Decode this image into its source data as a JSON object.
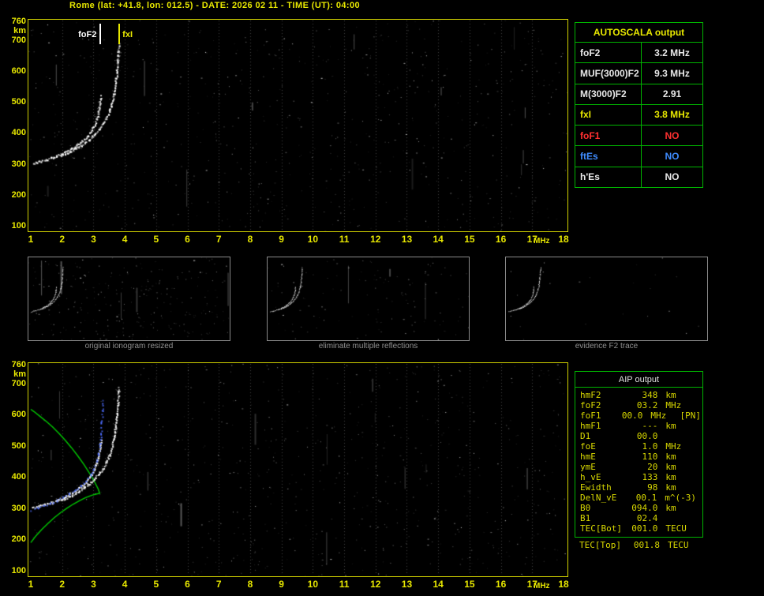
{
  "header": {
    "title": "Rome (lat: +41.8, lon: 012.5) - DATE: 2026 02 11 - TIME (UT): 04:00"
  },
  "colors": {
    "background": "#000000",
    "axis_yellow": "#e8e800",
    "plot_border": "#d0d000",
    "table_green": "#00b400",
    "white": "#e8e8e8",
    "red": "#ff3030",
    "blue": "#3f8cff",
    "trace_white": "#ffffff",
    "restored_blue": "#4d6dff",
    "profile_green": "#00c800",
    "caption_gray": "#8f8f8f",
    "aip_text": "#d8d800"
  },
  "autoscala_table": {
    "title": "AUTOSCALA output",
    "rows": [
      {
        "label": "foF2",
        "value": "3.2 MHz",
        "color": "#e8e8e8"
      },
      {
        "label": "MUF(3000)F2",
        "value": "9.3 MHz",
        "color": "#e8e8e8"
      },
      {
        "label": "M(3000)F2",
        "value": "2.91",
        "color": "#e8e8e8"
      },
      {
        "label": "fxI",
        "value": "3.8 MHz",
        "color": "#e8e800"
      },
      {
        "label": "foF1",
        "value": "NO",
        "color": "#ff3030"
      },
      {
        "label": "ftEs",
        "value": "NO",
        "color": "#3f8cff"
      },
      {
        "label": "h'Es",
        "value": "NO",
        "color": "#e8e8e8"
      }
    ]
  },
  "thumbnails": [
    {
      "caption": "original ionogram resized"
    },
    {
      "caption": "eliminate multiple reflections"
    },
    {
      "caption": "evidence F2 trace"
    }
  ],
  "aip_panel": {
    "title": "AIP output",
    "rows": [
      {
        "name": "hmF2",
        "value": "348",
        "unit": "km",
        "extra": ""
      },
      {
        "name": "foF2",
        "value": "03.2",
        "unit": "MHz",
        "extra": ""
      },
      {
        "name": "foF1",
        "value": "00.0",
        "unit": "MHz",
        "extra": "[PN]"
      },
      {
        "name": "hmF1",
        "value": "---",
        "unit": "km",
        "extra": ""
      },
      {
        "name": "D1",
        "value": "00.0",
        "unit": "",
        "extra": ""
      },
      {
        "name": "foE",
        "value": "1.0",
        "unit": "MHz",
        "extra": ""
      },
      {
        "name": "hmE",
        "value": "110",
        "unit": "km",
        "extra": ""
      },
      {
        "name": "ymE",
        "value": "20",
        "unit": "km",
        "extra": ""
      },
      {
        "name": "h_vE",
        "value": "133",
        "unit": "km",
        "extra": ""
      },
      {
        "name": "Ewidth",
        "value": "98",
        "unit": "km",
        "extra": ""
      },
      {
        "name": "DelN_vE",
        "value": "00.1",
        "unit": "m^(-3)",
        "extra": ""
      },
      {
        "name": "B0",
        "value": "094.0",
        "unit": "km",
        "extra": ""
      },
      {
        "name": "B1",
        "value": "02.4",
        "unit": "",
        "extra": ""
      },
      {
        "name": "TEC[Bot]",
        "value": "001.0",
        "unit": "TECU",
        "extra": ""
      }
    ],
    "outside_row": {
      "name": "TEC[Top]",
      "value": "001.8",
      "unit": "TECU"
    }
  },
  "chart_data": [
    {
      "type": "scatter",
      "title": "Autoscaled ionogram",
      "xlabel": "MHz",
      "ylabel": "km",
      "xlim": [
        1,
        18
      ],
      "ylim": [
        100,
        760
      ],
      "x_ticks": [
        1,
        2,
        3,
        4,
        5,
        6,
        7,
        8,
        9,
        10,
        11,
        12,
        13,
        14,
        15,
        16,
        17,
        18
      ],
      "y_ticks": [
        760,
        700,
        600,
        500,
        400,
        300,
        200,
        100
      ],
      "grid": "vertical-dotted",
      "legend": "none",
      "series": [
        {
          "name": "F2-trace-O-mode",
          "color": "#ffffff",
          "style": "dots",
          "points": [
            [
              1.05,
              302
            ],
            [
              1.25,
              308
            ],
            [
              1.45,
              314
            ],
            [
              1.65,
              320
            ],
            [
              1.8,
              326
            ],
            [
              1.95,
              332
            ],
            [
              2.1,
              340
            ],
            [
              2.25,
              348
            ],
            [
              2.4,
              357
            ],
            [
              2.55,
              368
            ],
            [
              2.7,
              380
            ],
            [
              2.82,
              394
            ],
            [
              2.93,
              410
            ],
            [
              3.02,
              428
            ],
            [
              3.09,
              448
            ],
            [
              3.15,
              470
            ],
            [
              3.19,
              495
            ],
            [
              3.22,
              520
            ]
          ]
        },
        {
          "name": "F2-trace-X-mode",
          "color": "#ffffff",
          "style": "dots",
          "points": [
            [
              1.95,
              328
            ],
            [
              2.1,
              334
            ],
            [
              2.25,
              341
            ],
            [
              2.4,
              349
            ],
            [
              2.55,
              358
            ],
            [
              2.7,
              368
            ],
            [
              2.85,
              380
            ],
            [
              3.0,
              394
            ],
            [
              3.15,
              410
            ],
            [
              3.28,
              428
            ],
            [
              3.4,
              448
            ],
            [
              3.5,
              472
            ],
            [
              3.58,
              500
            ],
            [
              3.64,
              530
            ],
            [
              3.69,
              562
            ],
            [
              3.73,
              596
            ],
            [
              3.76,
              630
            ],
            [
              3.78,
              660
            ],
            [
              3.8,
              688
            ]
          ]
        }
      ],
      "annotations": [
        {
          "label": "foF2",
          "x": 3.2,
          "color": "#ffffff",
          "side": "left"
        },
        {
          "label": "fxI",
          "x": 3.8,
          "color": "#e8e800",
          "side": "right"
        }
      ]
    },
    {
      "type": "scatter",
      "title": "Ionogram with restored trace and electron density profile",
      "xlabel": "MHz",
      "ylabel": "km",
      "xlim": [
        1,
        18
      ],
      "ylim": [
        100,
        760
      ],
      "x_ticks": [
        1,
        2,
        3,
        4,
        5,
        6,
        7,
        8,
        9,
        10,
        11,
        12,
        13,
        14,
        15,
        16,
        17,
        18
      ],
      "y_ticks": [
        760,
        700,
        600,
        500,
        400,
        300,
        200,
        100
      ],
      "grid": "vertical-dotted",
      "legend": "none",
      "series": [
        {
          "name": "electron-density-profile",
          "color": "#00c800",
          "style": "line",
          "points": [
            [
              1.0,
              190
            ],
            [
              1.15,
              210
            ],
            [
              1.35,
              232
            ],
            [
              1.55,
              252
            ],
            [
              1.75,
              270
            ],
            [
              1.95,
              286
            ],
            [
              2.15,
              300
            ],
            [
              2.35,
              313
            ],
            [
              2.55,
              324
            ],
            [
              2.75,
              334
            ],
            [
              2.95,
              342
            ],
            [
              3.1,
              346
            ],
            [
              3.2,
              348
            ],
            [
              3.15,
              362
            ],
            [
              3.05,
              382
            ],
            [
              2.9,
              408
            ],
            [
              2.7,
              440
            ],
            [
              2.5,
              468
            ],
            [
              2.3,
              494
            ],
            [
              2.1,
              518
            ],
            [
              1.9,
              540
            ],
            [
              1.7,
              560
            ],
            [
              1.5,
              578
            ],
            [
              1.3,
              594
            ],
            [
              1.1,
              610
            ],
            [
              1.0,
              617
            ]
          ]
        },
        {
          "name": "F2-trace-O-mode",
          "color": "#ffffff",
          "style": "dots",
          "points": [
            [
              1.05,
              302
            ],
            [
              1.25,
              308
            ],
            [
              1.45,
              314
            ],
            [
              1.65,
              320
            ],
            [
              1.8,
              326
            ],
            [
              1.95,
              332
            ],
            [
              2.1,
              340
            ],
            [
              2.25,
              348
            ],
            [
              2.4,
              357
            ],
            [
              2.55,
              368
            ],
            [
              2.7,
              380
            ],
            [
              2.82,
              394
            ],
            [
              2.93,
              410
            ],
            [
              3.02,
              428
            ],
            [
              3.09,
              448
            ],
            [
              3.15,
              470
            ],
            [
              3.19,
              495
            ],
            [
              3.22,
              520
            ]
          ]
        },
        {
          "name": "F2-trace-X-mode",
          "color": "#ffffff",
          "style": "dots",
          "points": [
            [
              1.95,
              328
            ],
            [
              2.1,
              334
            ],
            [
              2.25,
              341
            ],
            [
              2.4,
              349
            ],
            [
              2.55,
              358
            ],
            [
              2.7,
              368
            ],
            [
              2.85,
              380
            ],
            [
              3.0,
              394
            ],
            [
              3.15,
              410
            ],
            [
              3.28,
              428
            ],
            [
              3.4,
              448
            ],
            [
              3.5,
              472
            ],
            [
              3.58,
              500
            ],
            [
              3.64,
              530
            ],
            [
              3.69,
              562
            ],
            [
              3.73,
              596
            ],
            [
              3.76,
              630
            ],
            [
              3.78,
              660
            ],
            [
              3.8,
              688
            ]
          ]
        },
        {
          "name": "restored-trace",
          "color": "#4d6dff",
          "style": "dots-sparse",
          "points": [
            [
              1.0,
              296
            ],
            [
              1.2,
              302
            ],
            [
              1.4,
              309
            ],
            [
              1.6,
              317
            ],
            [
              1.8,
              326
            ],
            [
              2.0,
              336
            ],
            [
              2.2,
              347
            ],
            [
              2.4,
              360
            ],
            [
              2.58,
              374
            ],
            [
              2.74,
              390
            ],
            [
              2.88,
              408
            ],
            [
              3.0,
              428
            ],
            [
              3.09,
              452
            ],
            [
              3.15,
              478
            ],
            [
              3.2,
              508
            ],
            [
              3.23,
              540
            ],
            [
              3.25,
              575
            ],
            [
              3.27,
              612
            ],
            [
              3.28,
              648
            ]
          ]
        }
      ],
      "annotations": []
    }
  ]
}
